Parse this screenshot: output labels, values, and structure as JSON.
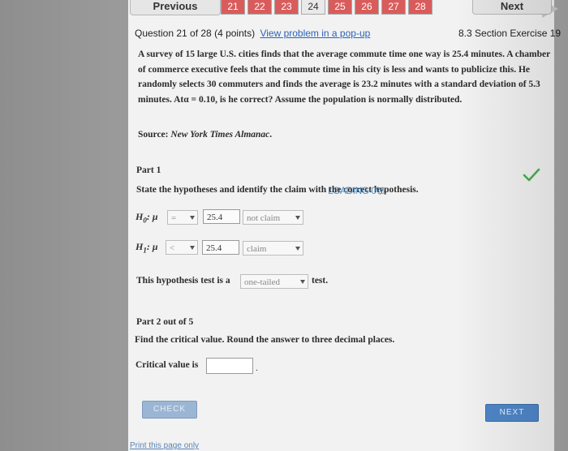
{
  "nav": {
    "prev_label": "Previous",
    "next_label": "Next",
    "question_tabs": [
      {
        "label": "21",
        "state": "done"
      },
      {
        "label": "22",
        "state": "done"
      },
      {
        "label": "23",
        "state": "done"
      },
      {
        "label": "24",
        "state": "open"
      },
      {
        "label": "25",
        "state": "done"
      },
      {
        "label": "26",
        "state": "done"
      },
      {
        "label": "27",
        "state": "done"
      },
      {
        "label": "28",
        "state": "done"
      }
    ]
  },
  "header": {
    "question_info": "Question 21 of 28 (4 points)",
    "popup_link": "View problem in a pop-up",
    "section": "8.3 Section Exercise 19"
  },
  "problem": {
    "text": "A survey of 15 large U.S. cities finds that the average commute time one way is 25.4 minutes. A chamber of commerce executive feels that the commute time in his city is less and wants to publicize this. He randomly selects 30 commuters and finds the average is 23.2 minutes with a standard deviation of 5.3 minutes. Atα = 0.10, is he correct? Assume the population is normally distributed.",
    "source_prefix": "Source: ",
    "source_name": "New York Times Almanac",
    "source_suffix": "."
  },
  "part1": {
    "label": "Part 1",
    "instruction": "State the hypotheses and identify the claim with the correct hypothesis.",
    "loading_text": "LOADING 0%",
    "h0": {
      "symbol": "H",
      "sub": "0",
      "mu": ": μ",
      "operator": "=",
      "value": "25.4",
      "claim": "not claim"
    },
    "h1": {
      "symbol": "H",
      "sub": "1",
      "mu": ": μ",
      "operator": "<",
      "value": "25.4",
      "claim": "claim"
    },
    "tail_prefix": "This hypothesis test is a",
    "tail_value": "one-tailed",
    "tail_suffix": "test."
  },
  "part2": {
    "label": "Part 2 out of 5",
    "instruction": "Find the critical value. Round the answer to three decimal places.",
    "critical_label": "Critical value is",
    "critical_value": "",
    "trailing": "."
  },
  "buttons": {
    "check": "CHECK",
    "next": "NEXT"
  },
  "footer": {
    "print_link": "Print this page only"
  },
  "colors": {
    "tab_done": "#d95c5c",
    "link": "#2a64b8",
    "check_mark": "#4caf50",
    "next_button": "#4f86c8"
  }
}
